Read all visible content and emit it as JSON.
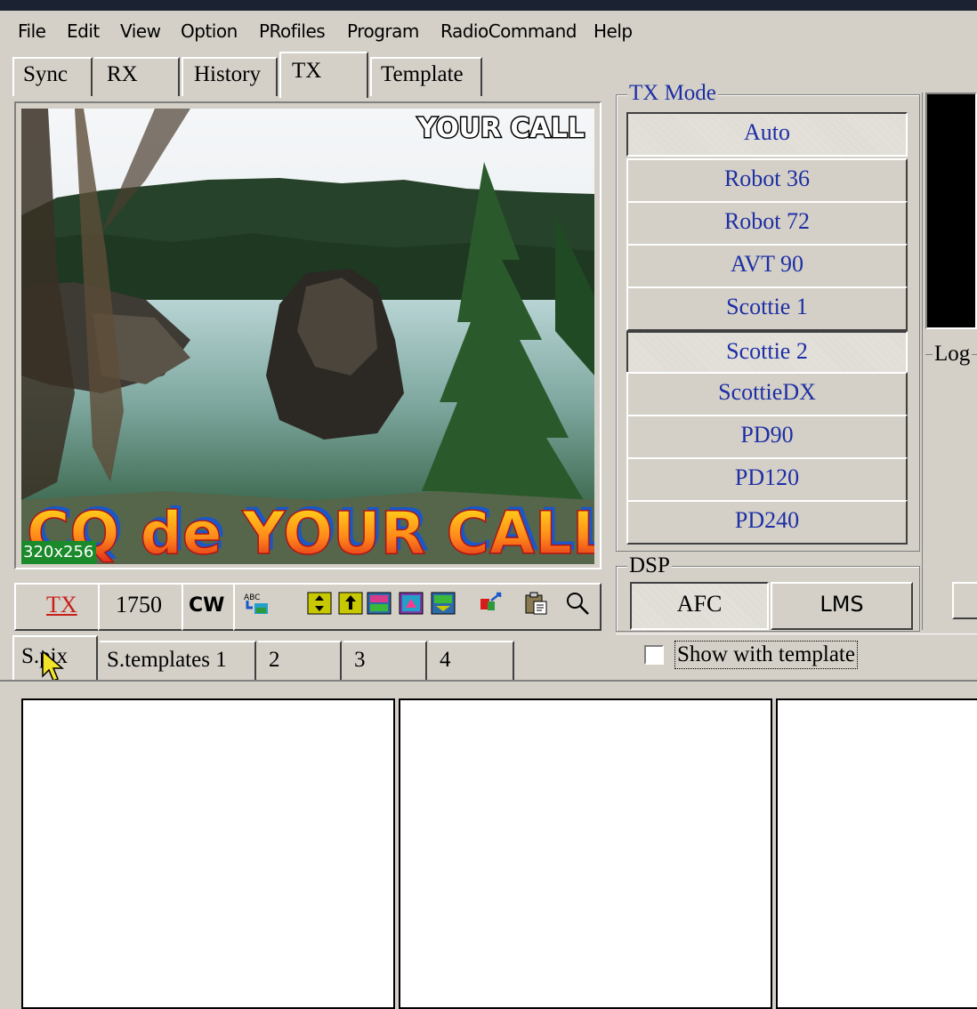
{
  "menu": [
    "File",
    "Edit",
    "View",
    "Option",
    "PRofiles",
    "Program",
    "RadioCommand",
    "Help"
  ],
  "tabs": [
    "Sync",
    "RX",
    "History",
    "TX",
    "Template"
  ],
  "active_tab": "TX",
  "image": {
    "overlay_top": "YOUR CALL",
    "overlay_bottom": "CQ de YOUR CALL",
    "size_badge": "320x256"
  },
  "tx_mode": {
    "label": "TX Mode",
    "buttons": [
      "Auto",
      "Robot 36",
      "Robot 72",
      "AVT 90",
      "Scottie 1",
      "Scottie 2",
      "ScottieDX",
      "PD90",
      "PD120",
      "PD240"
    ],
    "pressed": [
      "Auto",
      "Scottie 2"
    ]
  },
  "dsp": {
    "label": "DSP",
    "afc": "AFC",
    "lms": "LMS"
  },
  "log_label": "Log",
  "toolbar": {
    "tx": "TX",
    "tone": "1750",
    "cw": "CW"
  },
  "toolbar_icons": [
    "abc-text-icon",
    "flip-vertical-icon",
    "move-up-icon",
    "image-edit-icon",
    "image-fill-icon",
    "color-transfer-icon",
    "clipboard-paste-icon",
    "magnifier-icon"
  ],
  "bottom_tabs": [
    "S.pix",
    "S.templates 1",
    "2",
    "3",
    "4"
  ],
  "show_with_template": {
    "label": "Show with template",
    "checked": false
  },
  "colors": {
    "accent_blue": "#1d2fa4",
    "tx_red": "#c8201a",
    "badge_green": "#1a8a2a",
    "window_face": "#d4d0c8"
  }
}
